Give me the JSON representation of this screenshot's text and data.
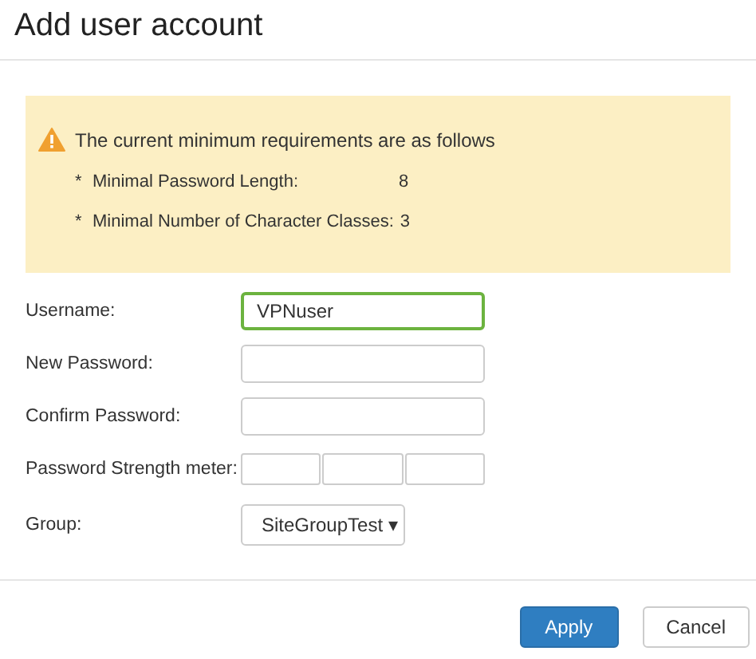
{
  "window": {
    "title": "Add user account"
  },
  "notice": {
    "heading": "The current minimum requirements are as follows",
    "items": [
      {
        "bullet": "*",
        "label": "Minimal Password Length:",
        "value": "8"
      },
      {
        "bullet": "*",
        "label": "Minimal Number of Character Classes:",
        "value": "3"
      }
    ]
  },
  "fields": [
    {
      "kind": "text",
      "label": "Username:",
      "value": "VPNuser",
      "focused": true
    },
    {
      "kind": "text",
      "label": "New Password:",
      "focused": false
    },
    {
      "kind": "text",
      "label": "Confirm Password:",
      "focused": false
    },
    {
      "kind": "meter",
      "label": "Password Strength meter:"
    },
    {
      "kind": "select",
      "label": "Group:",
      "value": "SiteGroupTest",
      "caret": "▾"
    }
  ],
  "buttons": [
    {
      "label": "Apply",
      "primary": true
    },
    {
      "label": "Cancel",
      "primary": false
    }
  ]
}
